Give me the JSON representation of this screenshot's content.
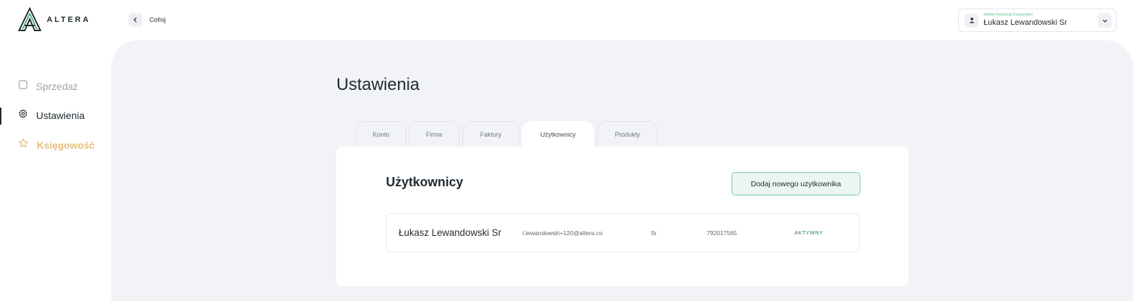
{
  "logo": {
    "text": "ALTERA"
  },
  "header": {
    "back_label": "Cofnij",
    "account": {
      "company": "Mellon Financial Corporation",
      "user_name": "Łukasz Lewandowski Sr"
    }
  },
  "sidebar": {
    "items": [
      {
        "label": "Sprzedaż",
        "icon": "square-icon",
        "color": "#9aa3a8"
      },
      {
        "label": "Ustawienia",
        "icon": "gear-icon",
        "color": "#1f2a30",
        "active": true
      },
      {
        "label": "Księgowość",
        "icon": "star-icon",
        "color": "#e6c07a"
      }
    ]
  },
  "main": {
    "title": "Ustawienia",
    "tabs": [
      {
        "label": "Konto"
      },
      {
        "label": "Firma"
      },
      {
        "label": "Faktury"
      },
      {
        "label": "Użytkownicy",
        "active": true
      },
      {
        "label": "Produkty"
      }
    ],
    "panel": {
      "title": "Użytkownicy",
      "add_button": "Dodaj nowego użytkownika",
      "users": [
        {
          "name": "Łukasz Lewandowski Sr",
          "email": "l.lewandowski+120@altera.co",
          "suffix": "Sr",
          "phone": "792017565",
          "status": "AKTYWNY"
        }
      ]
    }
  },
  "colors": {
    "accent_green": "#59c08a",
    "button_green_bg": "#eaf6ef",
    "main_bg": "#f1f3f7"
  }
}
